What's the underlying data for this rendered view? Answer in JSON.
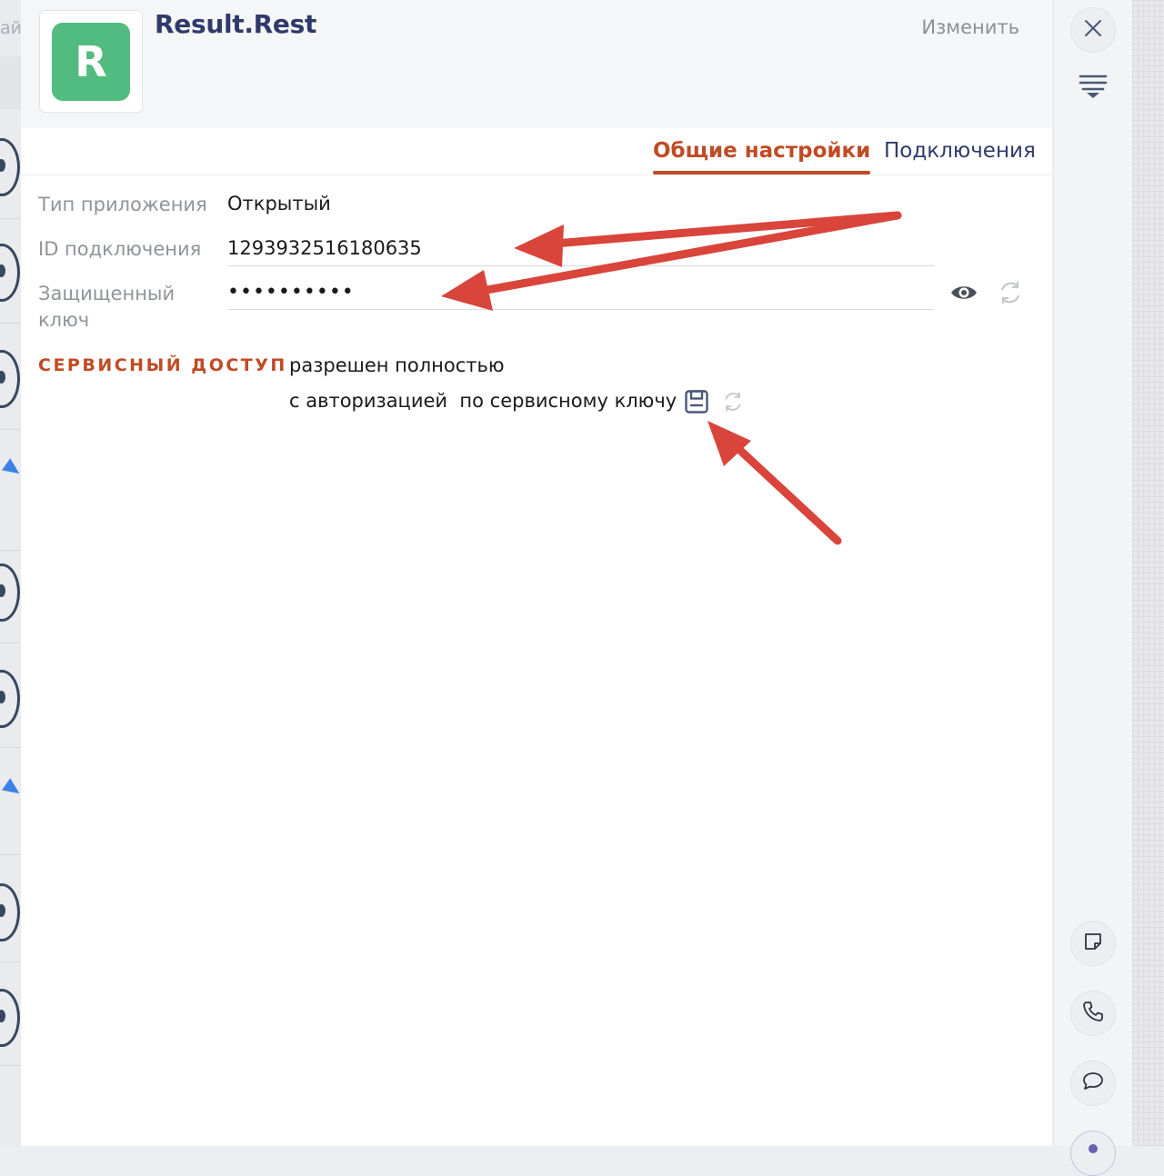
{
  "background": {
    "search_fragment": "ай"
  },
  "app": {
    "logo_letter": "R",
    "title": "Result.Rest",
    "edit_label": "Изменить"
  },
  "tabs": [
    {
      "label": "Общие настройки",
      "active": true
    },
    {
      "label": "Подключения",
      "active": false
    }
  ],
  "fields": {
    "app_type": {
      "label": "Тип приложения",
      "value": "Открытый"
    },
    "connection_id": {
      "label": "ID подключения",
      "value": "1293932516180635"
    },
    "secret_key": {
      "label_line1": "Защищенный",
      "label_line2": "ключ",
      "value": "••••••••••"
    }
  },
  "service_access": {
    "label": "СЕРВИСНЫЙ ДОСТУП",
    "line1": "разрешен полностью",
    "line2": "с авторизацией  по сервисному ключу"
  },
  "icons": {
    "close": "close-icon",
    "filter": "filter-list-icon",
    "eye": "eye-icon",
    "refresh": "refresh-icon",
    "save": "floppy-disk-icon",
    "note": "sticky-note-icon",
    "phone": "phone-icon",
    "chat": "chat-bubble-icon"
  },
  "colors": {
    "accent": "#c04b24",
    "title": "#2f3a6b",
    "logo": "#52bb7f",
    "annotation_arrow": "#d9443b"
  }
}
